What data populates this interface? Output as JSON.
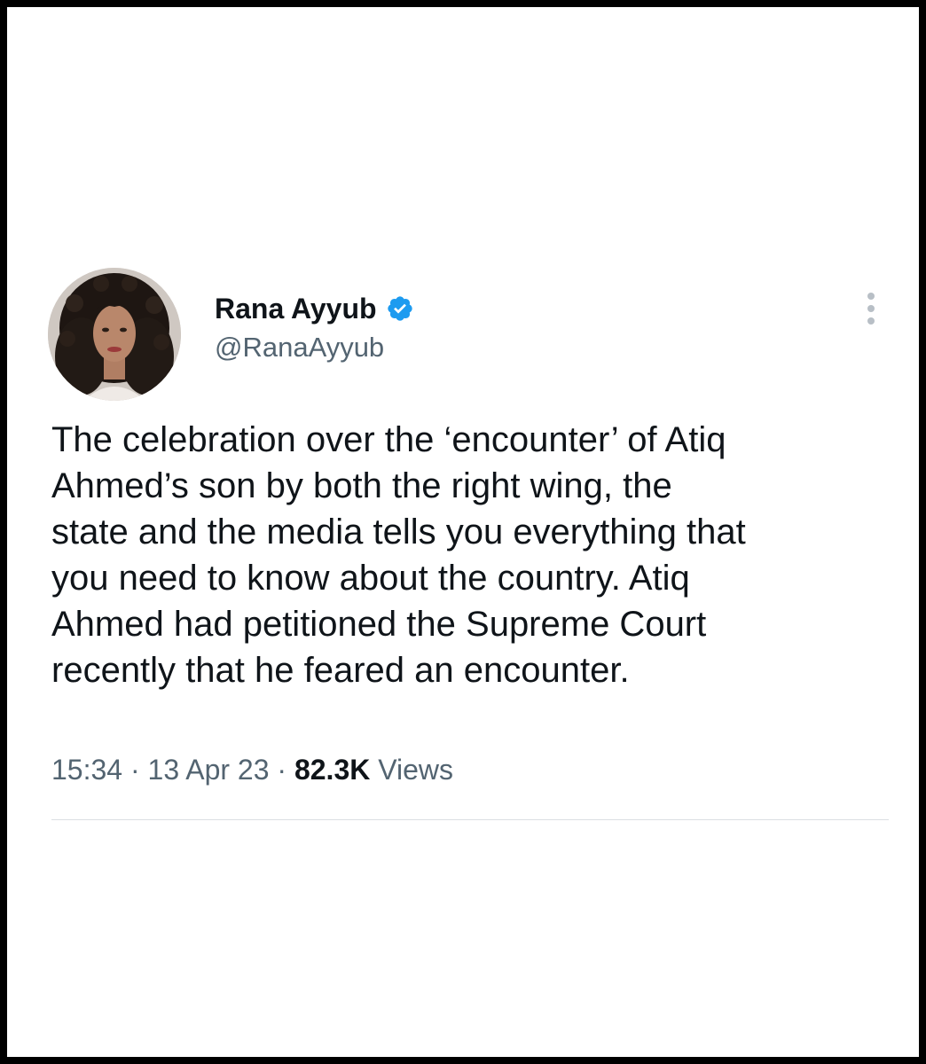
{
  "tweet": {
    "author": {
      "display_name": "Rana Ayyub",
      "handle": "@RanaAyyub",
      "verified_icon": "verified-badge-icon",
      "verified_color": "#1d9bf0"
    },
    "more_icon": "more-vertical-icon",
    "text": "The celebration over the ‘encounter’ of Atiq\nAhmed’s son by both the right wing, the\nstate and the media tells you everything that\nyou need to know about the country. Atiq\nAhmed had petitioned the Supreme Court\nrecently that he feared an encounter.",
    "time": "15:34",
    "separator": "·",
    "date": "13 Apr 23",
    "views_count": "82.3K",
    "views_label": "Views"
  },
  "colors": {
    "text_primary": "#0f1419",
    "text_secondary": "#536471",
    "divider": "#dcdfe3",
    "frame_border": "#000000"
  }
}
